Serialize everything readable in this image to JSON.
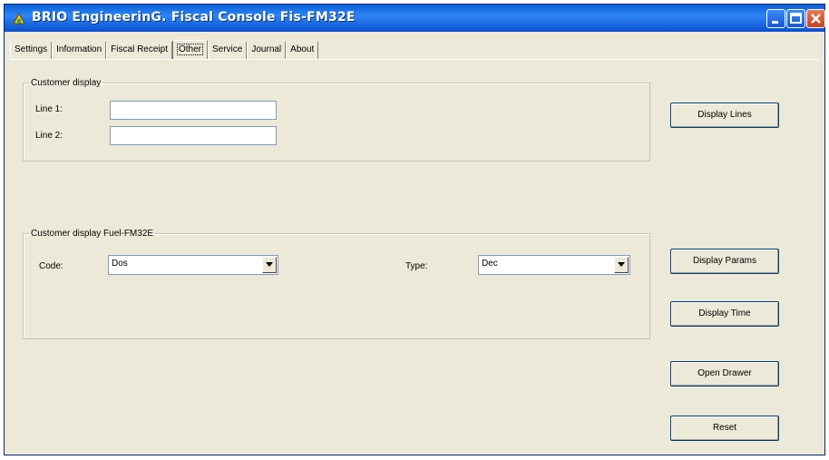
{
  "window": {
    "title": "BRIO EngineerinG. Fiscal Console Fis-FM32E"
  },
  "icons": {
    "app": "app-logo-icon",
    "minimize": "minimize-icon",
    "maximize": "maximize-icon",
    "close": "close-icon",
    "dropdown": "chevron-down-icon"
  },
  "tabs": [
    {
      "label": "Settings"
    },
    {
      "label": "Information"
    },
    {
      "label": "Fiscal Receipt"
    },
    {
      "label": "Other"
    },
    {
      "label": "Service"
    },
    {
      "label": "Journal"
    },
    {
      "label": "About"
    }
  ],
  "active_tab": "Other",
  "customer_display": {
    "legend": "Customer display",
    "line1_label": "Line 1:",
    "line1_value": "",
    "line2_label": "Line 2:",
    "line2_value": ""
  },
  "fuel_display": {
    "legend": "Customer display Fuel-FM32E",
    "code_label": "Code:",
    "code_value": "Dos",
    "type_label": "Type:",
    "type_value": "Dec"
  },
  "buttons": {
    "display_lines": "Display Lines",
    "display_params": "Display Params",
    "display_time": "Display Time",
    "open_drawer": "Open Drawer",
    "reset": "Reset"
  },
  "colors": {
    "titlebar": "#0a5fd8",
    "face": "#ece9d8",
    "input_border": "#7f9db9"
  }
}
